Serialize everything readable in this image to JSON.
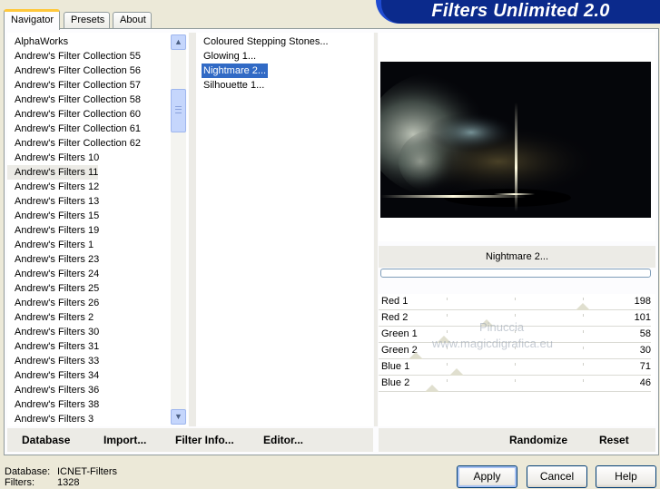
{
  "app": {
    "title": "Filters Unlimited 2.0"
  },
  "tabs": [
    {
      "label": "Navigator",
      "active": true
    },
    {
      "label": "Presets",
      "active": false
    },
    {
      "label": "About",
      "active": false
    }
  ],
  "categories": {
    "selected_index": 9,
    "items": [
      "AlphaWorks",
      "Andrew's Filter Collection 55",
      "Andrew's Filter Collection 56",
      "Andrew's Filter Collection 57",
      "Andrew's Filter Collection 58",
      "Andrew's Filter Collection 60",
      "Andrew's Filter Collection 61",
      "Andrew's Filter Collection 62",
      "Andrew's Filters 10",
      "Andrew's Filters 11",
      "Andrew's Filters 12",
      "Andrew's Filters 13",
      "Andrew's Filters 15",
      "Andrew's Filters 19",
      "Andrew's Filters 1",
      "Andrew's Filters 23",
      "Andrew's Filters 24",
      "Andrew's Filters 25",
      "Andrew's Filters 26",
      "Andrew's Filters 2",
      "Andrew's Filters 30",
      "Andrew's Filters 31",
      "Andrew's Filters 33",
      "Andrew's Filters 34",
      "Andrew's Filters 36",
      "Andrew's Filters 38",
      "Andrew's Filters 3"
    ]
  },
  "filters": {
    "selected_index": 2,
    "items": [
      "Coloured Stepping Stones...",
      "Glowing 1...",
      "Nightmare 2...",
      "Silhouette 1..."
    ]
  },
  "preview": {
    "filter_name": "Nightmare 2...",
    "progress": 0
  },
  "sliders": [
    {
      "label": "Red 1",
      "value": "198",
      "max": 255
    },
    {
      "label": "Red 2",
      "value": "101",
      "max": 255
    },
    {
      "label": "Green 1",
      "value": "58",
      "max": 255
    },
    {
      "label": "Green 2",
      "value": "30",
      "max": 255
    },
    {
      "label": "Blue 1",
      "value": "71",
      "max": 255
    },
    {
      "label": "Blue 2",
      "value": "46",
      "max": 255
    }
  ],
  "watermark": {
    "line1": "Pinuccia",
    "line2": "www.magicdigrafica.eu"
  },
  "toolbar": {
    "database": "Database",
    "import": "Import...",
    "filter_info": "Filter Info...",
    "editor": "Editor...",
    "randomize": "Randomize",
    "reset": "Reset"
  },
  "status": {
    "database_label": "Database:",
    "database_value": "ICNET-Filters",
    "filters_label": "Filters:",
    "filters_value": "1328"
  },
  "buttons": {
    "apply": "Apply",
    "cancel": "Cancel",
    "help": "Help"
  },
  "icons": {
    "scroll_up": "arrow-up-icon",
    "scroll_down": "arrow-down-icon"
  }
}
